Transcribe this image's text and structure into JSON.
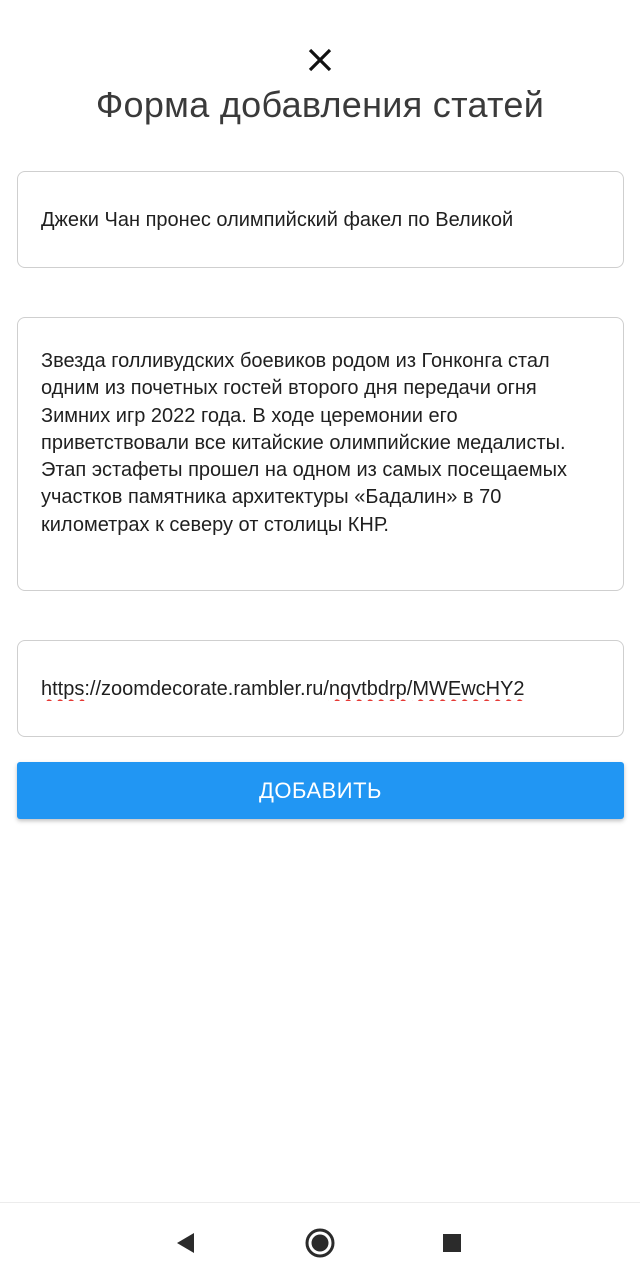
{
  "header": {
    "close_icon": "close-icon",
    "title": "Форма добавления статей"
  },
  "form": {
    "title_value": "Джеки Чан пронес олимпийский факел по Великой",
    "body_value": "Звезда голливудских боевиков родом из Гонконга стал одним из почетных гостей второго дня передачи огня Зимних игр 2022 года. В ходе церемонии его приветствовали все китайские олимпийские медалисты. Этап эстафеты прошел на одном из самых посещаемых участков памятника архитектуры «Бадалин» в 70 километрах к северу от столицы КНР.",
    "link_parts": {
      "p1": "https",
      "p2": "://zoomdecorate.rambler.ru/",
      "p3": "nqvtbdrp",
      "p4": "/",
      "p5": "MWEwcHY2"
    },
    "submit_label": "ДОБАВИТЬ"
  },
  "colors": {
    "accent": "#2196f3",
    "spellcheck": "#e53935",
    "border": "#cfcfcf"
  },
  "navbar": {
    "back_icon": "back-triangle-icon",
    "home_icon": "home-circle-icon",
    "recent_icon": "recent-square-icon"
  }
}
